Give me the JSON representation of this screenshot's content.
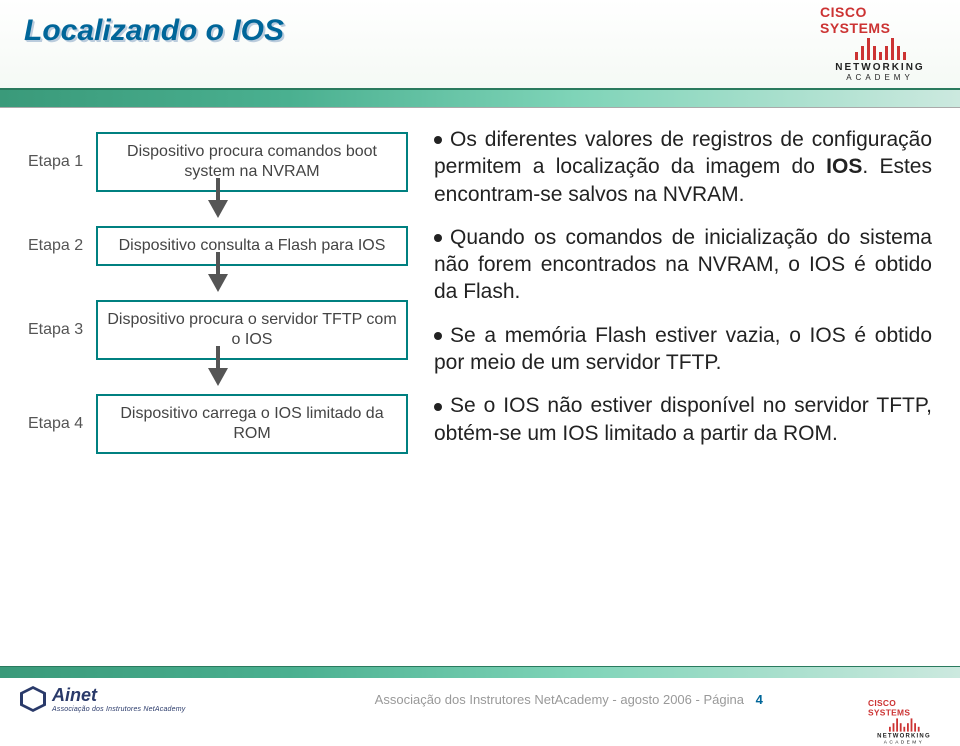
{
  "header": {
    "title": "Localizando o IOS",
    "logo_top": "CISCO SYSTEMS",
    "logo_mid": "NETWORKING",
    "logo_sub": "ACADEMY"
  },
  "diagram": {
    "steps": [
      {
        "label": "Etapa 1",
        "text": "Dispositivo procura comandos boot system na NVRAM"
      },
      {
        "label": "Etapa 2",
        "text": "Dispositivo consulta a Flash para IOS"
      },
      {
        "label": "Etapa 3",
        "text": "Dispositivo procura o servidor TFTP com o IOS"
      },
      {
        "label": "Etapa 4",
        "text": "Dispositivo carrega o IOS limitado da ROM"
      }
    ]
  },
  "body": {
    "p1a": "Os diferentes valores de registros de configuração permitem a localização da imagem do ",
    "p1b": "IOS",
    "p1c": ". Estes encontram-se salvos na NVRAM.",
    "p2": "Quando os comandos de inicialização do sistema não forem encontrados na NVRAM, o IOS é obtido da Flash.",
    "p3": "Se a memória Flash estiver vazia, o IOS é obtido por meio de um servidor TFTP.",
    "p4": "Se o IOS não estiver disponível no servidor TFTP, obtém-se um IOS limitado a partir da ROM."
  },
  "footer": {
    "ainet": "Ainet",
    "ainet_sub": "Associação dos Instrutores NetAcademy",
    "text": "Associação dos Instrutores NetAcademy - agosto 2006 - Página",
    "page": "4"
  }
}
